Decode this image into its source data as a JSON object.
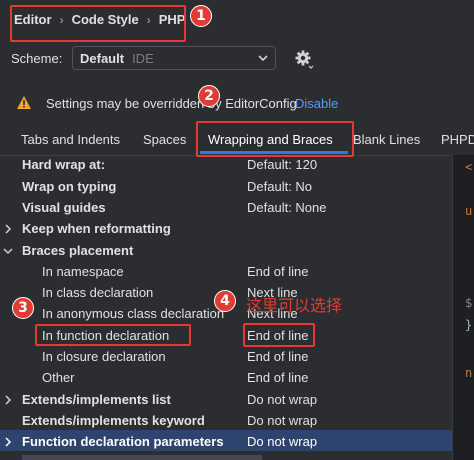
{
  "breadcrumb": {
    "items": [
      "Editor",
      "Code Style",
      "PHP"
    ],
    "separator": "›"
  },
  "scheme": {
    "label": "Scheme:",
    "value": "Default",
    "sub": "IDE"
  },
  "warning": {
    "text": "Settings may be overridden by EditorConfig",
    "link": "Disable"
  },
  "tabs": [
    "Tabs and Indents",
    "Spaces",
    "Wrapping and Braces",
    "Blank Lines",
    "PHPD"
  ],
  "rows": {
    "hard_wrap": {
      "label": "Hard wrap at:",
      "value": "Default: 120"
    },
    "wrap_typing": {
      "label": "Wrap on typing",
      "value": "Default: No"
    },
    "visual_guides": {
      "label": "Visual guides",
      "value": "Default: None"
    },
    "keep_reformat": {
      "label": "Keep when reformatting"
    },
    "braces": {
      "label": "Braces placement"
    },
    "in_namespace": {
      "label": "In namespace",
      "value": "End of line"
    },
    "in_class": {
      "label": "In class declaration",
      "value": "Next line"
    },
    "in_anon_class": {
      "label": "In anonymous class declaration",
      "value": "Next line"
    },
    "in_function": {
      "label": "In function declaration",
      "value": "End of line"
    },
    "in_closure": {
      "label": "In closure declaration",
      "value": "End of line"
    },
    "other": {
      "label": "Other",
      "value": "End of line"
    },
    "extends_list": {
      "label": "Extends/implements list",
      "value": "Do not wrap"
    },
    "extends_keyword": {
      "label": "Extends/implements keyword",
      "value": "Do not wrap"
    },
    "func_params": {
      "label": "Function declaration parameters",
      "value": "Do not wrap"
    }
  },
  "annotations": {
    "b1": "1",
    "b2": "2",
    "b3": "3",
    "b4": "4",
    "note": "这里可以选择"
  },
  "code_preview": [
    "<",
    "u",
    "$",
    "}",
    "n"
  ],
  "colors": {
    "accent": "#3574f0",
    "annotation": "#e23b34",
    "link": "#589df6",
    "warning": "#f0a732",
    "selected": "#2e436e"
  }
}
